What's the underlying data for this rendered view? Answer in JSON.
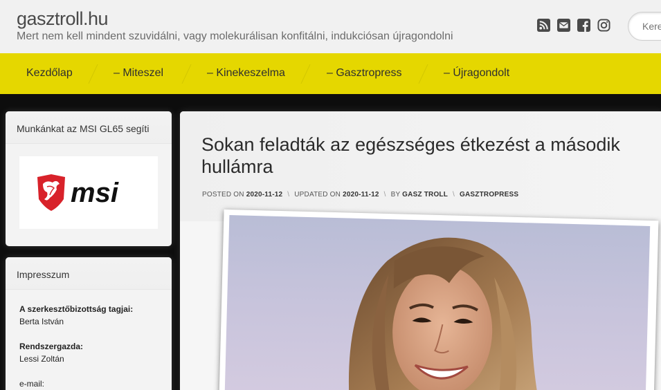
{
  "site": {
    "title": "gasztroll.hu",
    "tagline": "Mert nem kell mindent szuvidálni, vagy molekurálisan konfitálni, indukciósan újragondolni",
    "search_placeholder": "Keresés"
  },
  "social_icons": [
    "rss-icon",
    "envelope-icon",
    "facebook-icon",
    "instagram-icon"
  ],
  "nav": {
    "items": [
      "Kezdőlap",
      "– Miteszel",
      "– Kinekeszelma",
      "– Gasztropress",
      "– Újragondolt"
    ]
  },
  "sidebar": {
    "sponsor_widget": {
      "title": "Munkánkat az MSI GL65 segíti",
      "logo_text": "msi"
    },
    "impressum": {
      "title": "Impresszum",
      "rows": [
        {
          "label": "A szerkesztőbizottság tagjai:",
          "value": "Berta István"
        },
        {
          "label": "Rendszergazda:",
          "value": "Lessi Zoltán"
        },
        {
          "label": "e-mail:",
          "value": ""
        }
      ]
    }
  },
  "article": {
    "title": "Sokan feladták az egészséges étkezést a második hullámra",
    "meta": {
      "posted_label": "Posted on",
      "posted_date": "2020-11-12",
      "updated_label": "Updated on",
      "updated_date": "2020-11-12",
      "by_label": "by",
      "author": "Gasz Troll",
      "category": "Gasztropress"
    }
  },
  "colors": {
    "nav_bg": "#e5d700",
    "header_bg": "#f1f1f1",
    "page_bg": "#0d0d0d",
    "msi_red": "#d8222a"
  }
}
